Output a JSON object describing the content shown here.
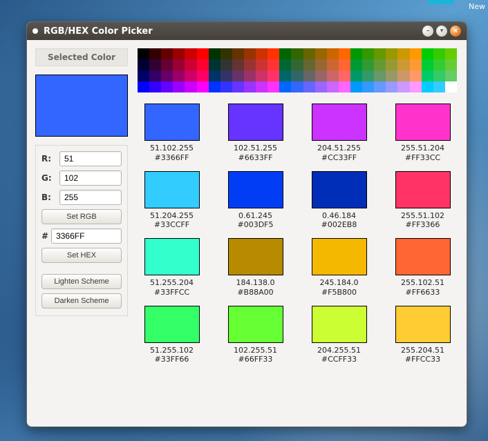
{
  "panel": {
    "new_label": "New"
  },
  "window": {
    "title": "RGB/HEX Color Picker"
  },
  "left": {
    "selected_heading": "Selected Color",
    "selected_color": "#3366FF",
    "r_label": "R:",
    "g_label": "G:",
    "b_label": "B:",
    "r_value": "51",
    "g_value": "102",
    "b_value": "255",
    "set_rgb": "Set RGB",
    "hash": "#",
    "hex_value": "3366FF",
    "set_hex": "Set HEX",
    "lighten": "Lighten Scheme",
    "darken": "Darken Scheme"
  },
  "palette_rows": [
    [
      "#000000",
      "#330000",
      "#660000",
      "#990000",
      "#CC0000",
      "#FF0000",
      "#003300",
      "#333300",
      "#663300",
      "#993300",
      "#CC3300",
      "#FF3300",
      "#006600",
      "#336600",
      "#666600",
      "#996600",
      "#CC6600",
      "#FF6600",
      "#009900",
      "#339900",
      "#669900",
      "#999900",
      "#CC9900",
      "#FF9900",
      "#00CC00",
      "#33CC00",
      "#66CC00"
    ],
    [
      "#000033",
      "#330033",
      "#660033",
      "#990033",
      "#CC0033",
      "#FF0033",
      "#003333",
      "#333333",
      "#663333",
      "#993333",
      "#CC3333",
      "#FF3333",
      "#006633",
      "#336633",
      "#666633",
      "#996633",
      "#CC6633",
      "#FF6633",
      "#009933",
      "#339933",
      "#669933",
      "#999933",
      "#CC9933",
      "#FF9933",
      "#00CC33",
      "#33CC33",
      "#66CC33"
    ],
    [
      "#000066",
      "#330066",
      "#660066",
      "#990066",
      "#CC0066",
      "#FF0066",
      "#003366",
      "#333366",
      "#663366",
      "#993366",
      "#CC3366",
      "#FF3366",
      "#006666",
      "#336666",
      "#666666",
      "#996666",
      "#CC6666",
      "#FF6666",
      "#009966",
      "#339966",
      "#669966",
      "#999966",
      "#CC9966",
      "#FF9966",
      "#00CC66",
      "#33CC66",
      "#66CC66"
    ],
    [
      "#0000FF",
      "#3300FF",
      "#6600FF",
      "#9900FF",
      "#CC00FF",
      "#FF00FF",
      "#0033FF",
      "#3333FF",
      "#6633FF",
      "#9933FF",
      "#CC33FF",
      "#FF33FF",
      "#0066FF",
      "#3366FF",
      "#6666FF",
      "#9966FF",
      "#CC66FF",
      "#FF66FF",
      "#0099FF",
      "#3399FF",
      "#6699FF",
      "#9999FF",
      "#CC99FF",
      "#FF99FF",
      "#00CCFF",
      "#33CCFF",
      "#FFFFFF"
    ]
  ],
  "swatches": [
    {
      "color": "#3366FF",
      "rgb": "51.102.255",
      "hex": "#3366FF"
    },
    {
      "color": "#6633FF",
      "rgb": "102.51.255",
      "hex": "#6633FF"
    },
    {
      "color": "#CC33FF",
      "rgb": "204.51.255",
      "hex": "#CC33FF"
    },
    {
      "color": "#FF33CC",
      "rgb": "255.51.204",
      "hex": "#FF33CC"
    },
    {
      "color": "#33CCFF",
      "rgb": "51.204.255",
      "hex": "#33CCFF"
    },
    {
      "color": "#003DF5",
      "rgb": "0.61.245",
      "hex": "#003DF5"
    },
    {
      "color": "#002EB8",
      "rgb": "0.46.184",
      "hex": "#002EB8"
    },
    {
      "color": "#FF3366",
      "rgb": "255.51.102",
      "hex": "#FF3366"
    },
    {
      "color": "#33FFCC",
      "rgb": "51.255.204",
      "hex": "#33FFCC"
    },
    {
      "color": "#B88A00",
      "rgb": "184.138.0",
      "hex": "#B88A00"
    },
    {
      "color": "#F5B800",
      "rgb": "245.184.0",
      "hex": "#F5B800"
    },
    {
      "color": "#FF6633",
      "rgb": "255.102.51",
      "hex": "#FF6633"
    },
    {
      "color": "#33FF66",
      "rgb": "51.255.102",
      "hex": "#33FF66"
    },
    {
      "color": "#66FF33",
      "rgb": "102.255.51",
      "hex": "#66FF33"
    },
    {
      "color": "#CCFF33",
      "rgb": "204.255.51",
      "hex": "#CCFF33"
    },
    {
      "color": "#FFCC33",
      "rgb": "255.204.51",
      "hex": "#FFCC33"
    }
  ]
}
